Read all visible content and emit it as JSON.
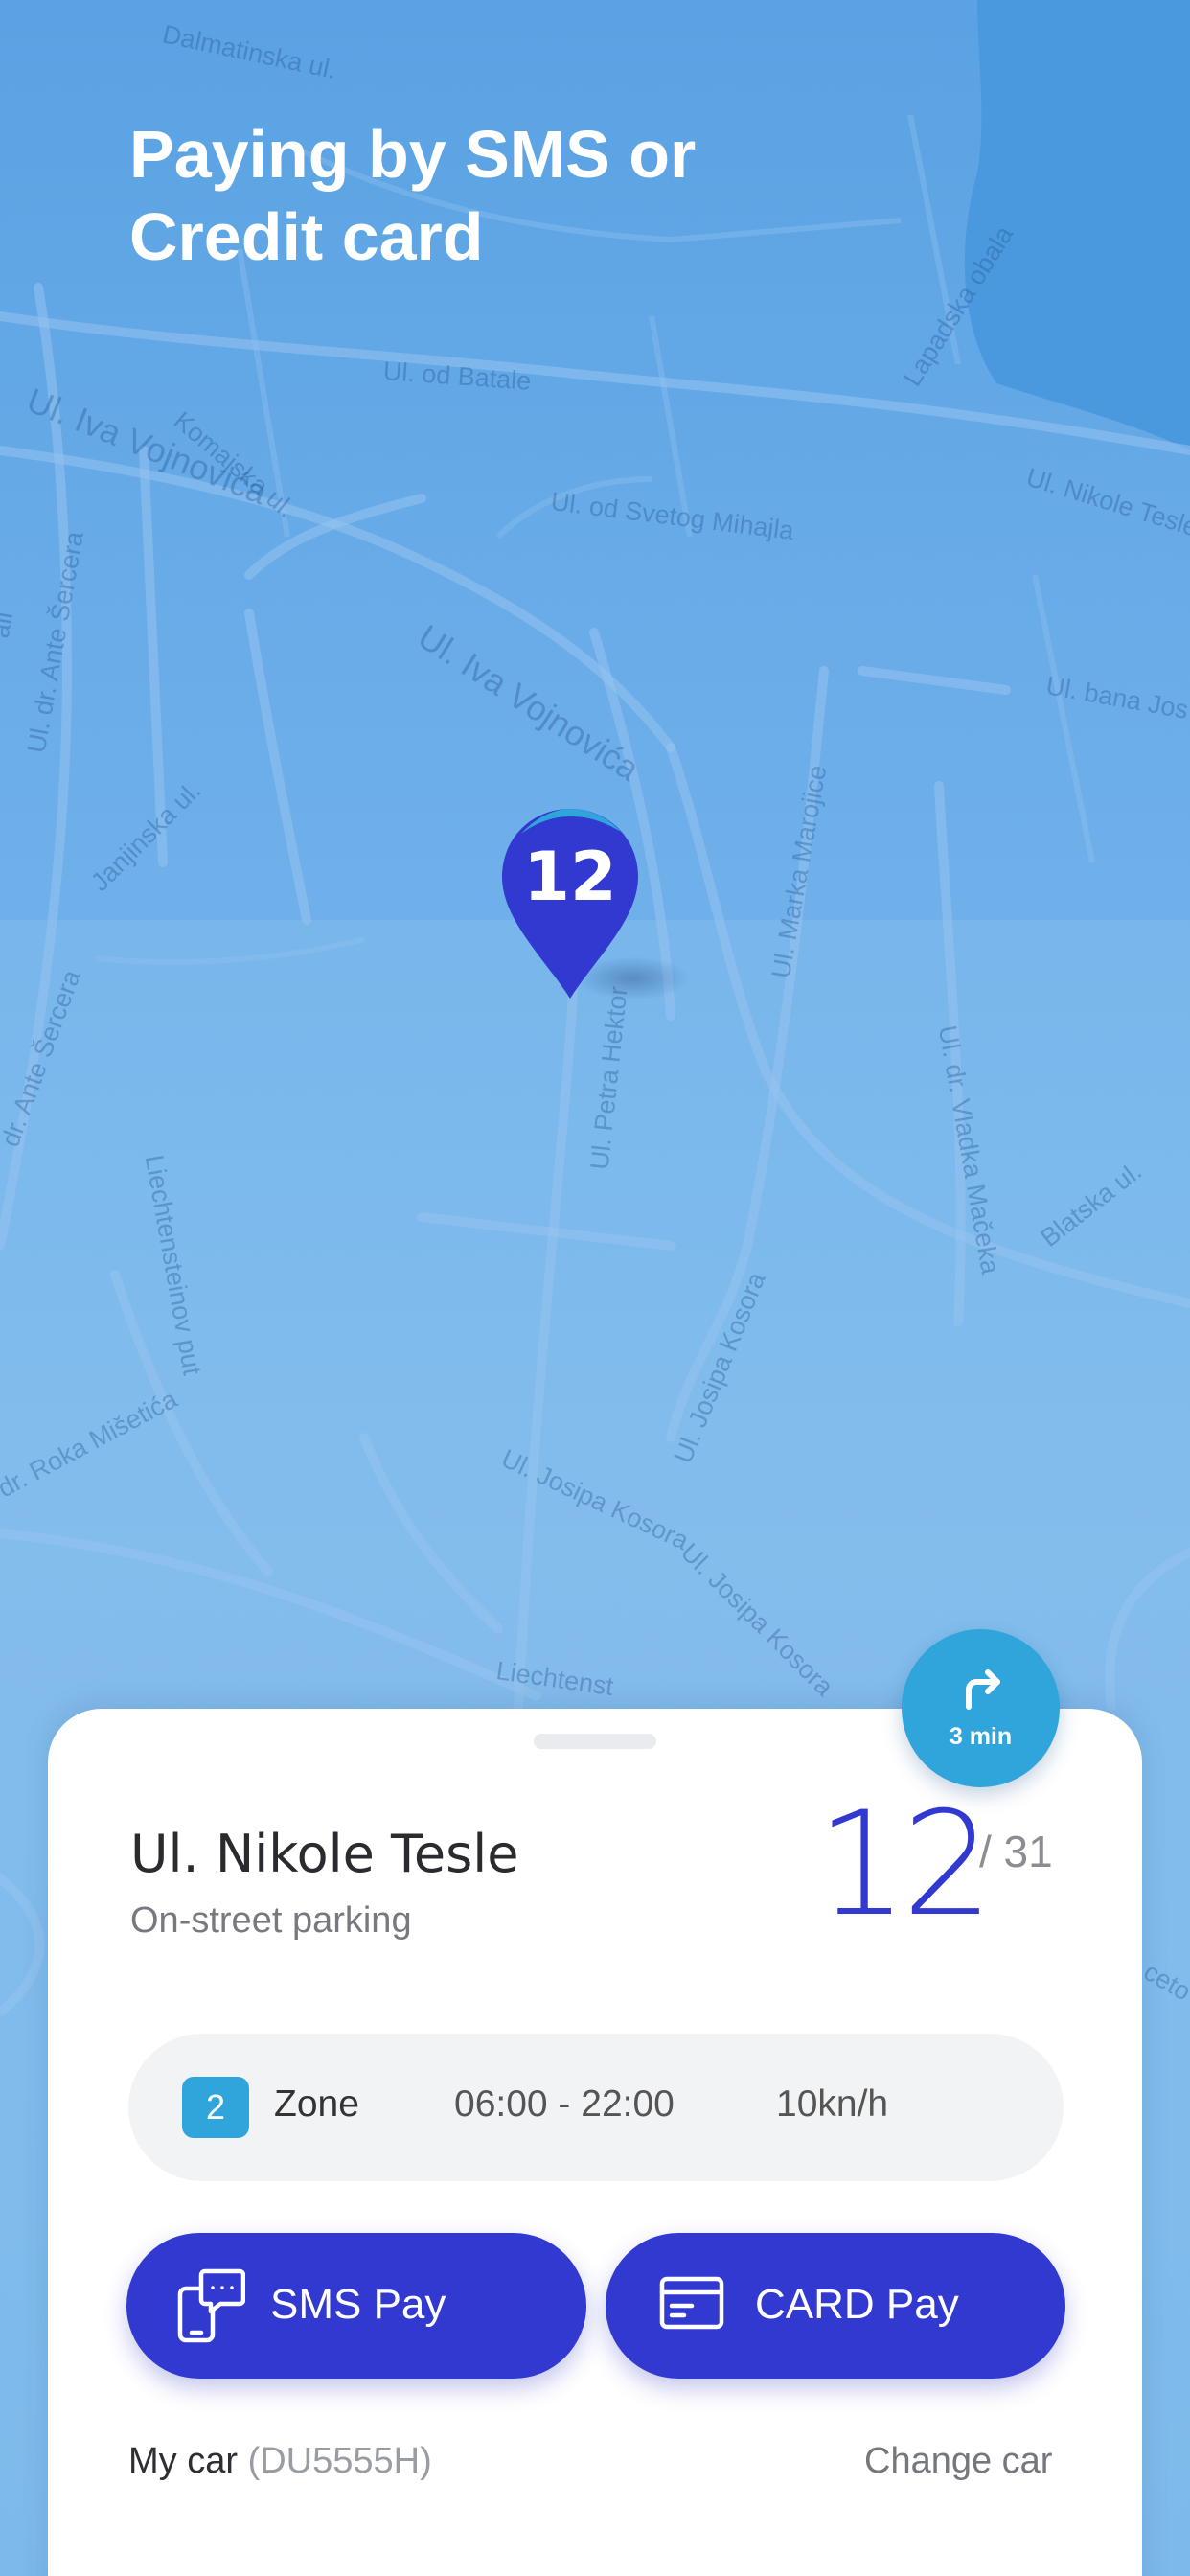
{
  "header": {
    "title_line1": "Paying by SMS or",
    "title_line2": "Credit card"
  },
  "map": {
    "streets": [
      "Dalmatinska ul.",
      "Ul. od Batale",
      "Komajska ul.",
      "Ul. Iva Vojnovića",
      "Ul. od Svetog Mihajla",
      "Lapadska obala",
      "Ul. Nikole Tesle",
      "Ul. dr. Ante Šercera",
      "Ul. Iva Vojnovića",
      "Janjinska ul.",
      "Ul. bana Jos",
      "Ul. Marka Marojice",
      "Ul. Petra Hektor",
      "Ul. dr. Vladka Mačeka",
      "Blatska ul.",
      "dr. Ante Šercera",
      "Liechtensteinov put",
      "Ul. Josipa Kosora",
      "dr. Roka Mišetića",
      "Ul. Josipa Kosora",
      "Ul. Josipa Kosora",
      "Liechtenst",
      "ali",
      "ceto"
    ],
    "marker_label": "12",
    "colors": {
      "water": "#4a99df",
      "land": "#7ab6ea",
      "marker": "#3239d1"
    }
  },
  "route": {
    "icon": "turn-right-arrow-icon",
    "time": "3 min"
  },
  "sheet": {
    "street_name": "Ul. Nikole Tesle",
    "parking_type": "On-street parking",
    "free_spots": "12",
    "total_spots": "/ 31",
    "zone": {
      "number": "2",
      "label": "Zone",
      "hours": "06:00 - 22:00",
      "price": "10kn/h"
    },
    "buttons": {
      "sms": {
        "label": "SMS Pay",
        "icon": "sms-phone-icon"
      },
      "card": {
        "label": "CARD Pay",
        "icon": "credit-card-icon"
      }
    },
    "car": {
      "label": "My car",
      "plate": "(DU5555H)",
      "change_label": "Change car"
    },
    "colors": {
      "accent": "#3239d1",
      "zone_badge": "#2fa5dc",
      "pill_bg": "#f2f3f5"
    }
  }
}
